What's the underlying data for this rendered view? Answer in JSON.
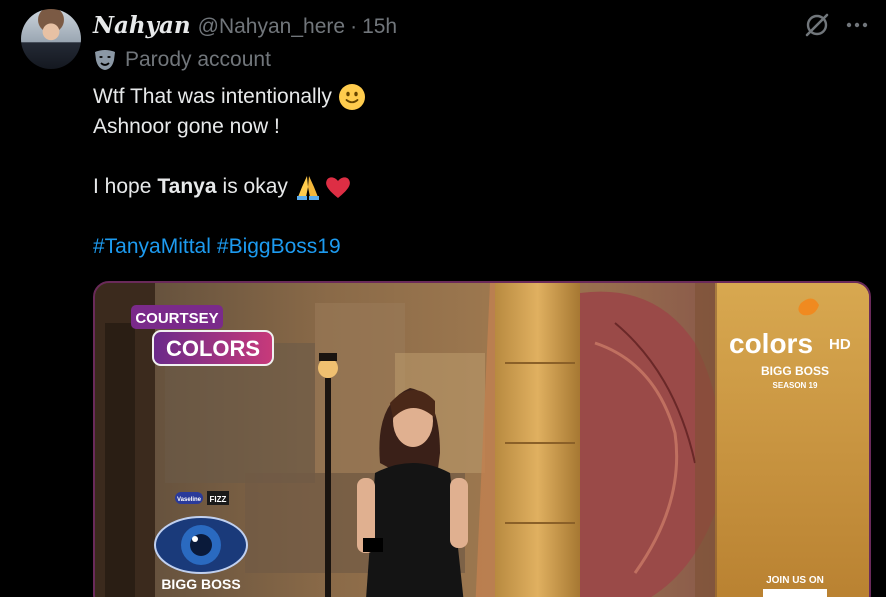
{
  "post": {
    "display_name": "Nahyan",
    "handle": "@Nahyan_here",
    "separator": "·",
    "time": "15h",
    "badge": {
      "icon": "parody-mask-icon",
      "label": "Parody account"
    },
    "actions": {
      "grok_icon": "grok-icon",
      "more_icon": "more-icon"
    },
    "text": {
      "line1": "Wtf That was intentionally",
      "line1_emoji": "slightly-smiling-face",
      "line2": "Ashnoor gone now !",
      "line3_prefix": "I hope",
      "line3_bold": "Tanya",
      "line3_suffix": "is okay",
      "line3_emojis": [
        "folded-hands",
        "red-heart"
      ],
      "hashtags": [
        "#TanyaMittal",
        "#BiggBoss19"
      ]
    },
    "media": {
      "courtsey_label": "COURTSEY",
      "colors_label": "COLORS",
      "channel_logo": "colors",
      "channel_hd": "HD",
      "show_title": "BIGG BOSS",
      "season": "SEASON 19",
      "join_us": "JOIN US ON",
      "bottom_logo": "BIGG BOSS",
      "sponsor_1": "Vaseline",
      "sponsor_2": "FIZZ"
    }
  },
  "colors": {
    "background": "#000000",
    "text": "#e7e9ea",
    "muted": "#71767b",
    "link": "#1d9bf0"
  }
}
